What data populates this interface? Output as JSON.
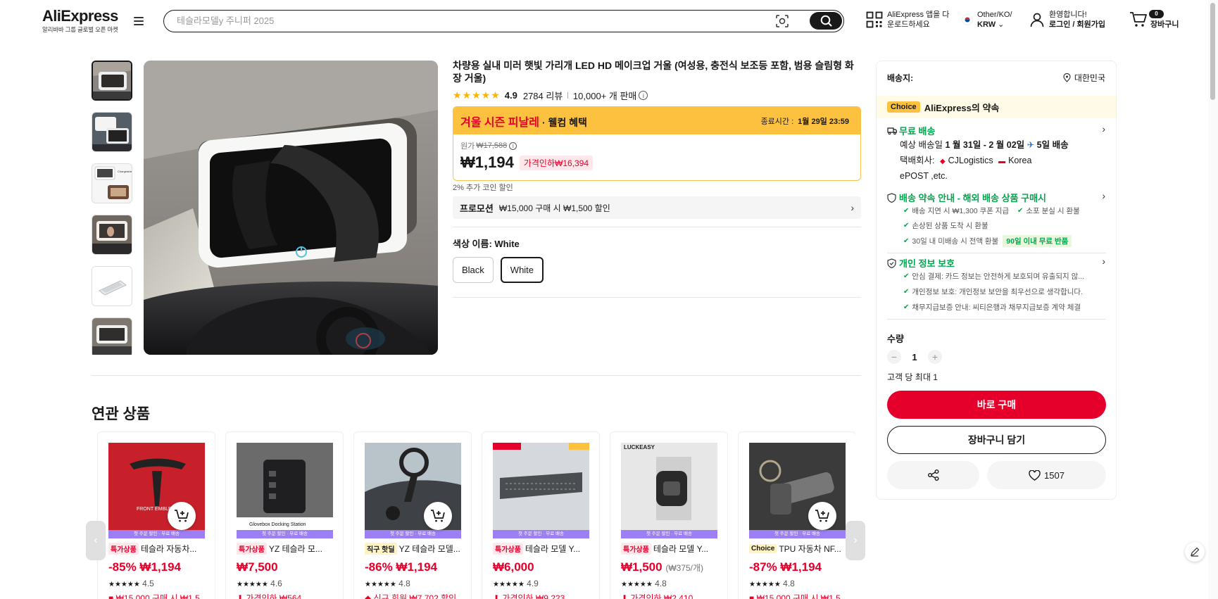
{
  "header": {
    "logo": "AliExpress",
    "logo_sub": "알리바바 그룹 글로벌 오픈 마켓",
    "search_placeholder": "테슬라모델y 주니퍼 2025",
    "app_line1": "AliExpress 앱을 다",
    "app_line2": "운로드하세요",
    "region_line1": "Other/KO/",
    "region_line2": "KRW",
    "account_line1": "환영합니다!",
    "account_line2": "로그인 / 회원가입",
    "cart_count": "0",
    "cart_label": "장바구니"
  },
  "product": {
    "title": "차량용 실내 미러 햇빛 가리개 LED HD 메이크업 거울 (여성용, 충전식 보조등 포함, 범용 슬림형 화장 거울)",
    "rating": "4.9",
    "reviews": "2784 리뷰",
    "sold": "10,000+ 개 판매",
    "deal_name": "겨울 시즌 피날레",
    "deal_sub": "· 웰컴 혜택",
    "deal_end_label": "종료시간 :",
    "deal_end_time": "1월 29일 23:59",
    "orig_label": "원가",
    "orig_price": "₩17,588",
    "price": "₩1,194",
    "discount": "가격인하₩16,394",
    "coin": "2% 추가 코인 할인",
    "promo_label": "프로모션",
    "promo_text": "₩15,000 구매 시 ₩1,500 할인",
    "color_label": "색상 이름:",
    "color_value": "White",
    "colors": [
      "Black",
      "White"
    ],
    "selected_color": "White"
  },
  "related": {
    "title": "연관 상품",
    "strip": "첫 주문 할인 · 무료 배송",
    "items": [
      {
        "tag": "특가상품",
        "tag_style": "red",
        "name": "테슬라 자동차...",
        "price": "-85% ₩1,194",
        "unit": "",
        "price_style": "red",
        "rating": "4.5",
        "promo": "₩15,000 구매 시 ₩1,5"
      },
      {
        "tag": "특가상품",
        "tag_style": "red",
        "name": "YZ 테슬라 모...",
        "price": "₩7,500",
        "unit": "",
        "price_style": "red",
        "rating": "4.6",
        "promo": "가격인하 ₩564"
      },
      {
        "tag": "직구 핫딜",
        "tag_style": "yellow",
        "name": "YZ 테슬라 모델...",
        "price": "-86% ₩1,194",
        "unit": "",
        "price_style": "red",
        "rating": "4.8",
        "promo": "신규 회원 ₩7,702 할인"
      },
      {
        "tag": "특가상품",
        "tag_style": "red",
        "name": "테슬라 모델 Y...",
        "price": "₩6,000",
        "unit": "",
        "price_style": "red",
        "rating": "4.9",
        "promo": "가격인하 ₩9,223"
      },
      {
        "tag": "특가상품",
        "tag_style": "red",
        "name": "테슬라 모델 Y...",
        "price": "₩1,500",
        "unit": "(₩375/개)",
        "price_style": "red",
        "rating": "4.8",
        "promo": "가격인하 ₩2,410"
      },
      {
        "tag": "Choice",
        "tag_style": "yellow",
        "name": "TPU 자동차 NF...",
        "price": "-87% ₩1,194",
        "unit": "",
        "price_style": "red",
        "rating": "4.8",
        "promo": "₩15,000 구매 시 ₩1,5"
      }
    ]
  },
  "panel": {
    "ship_to": "배송지:",
    "ship_loc": "대한민국",
    "choice_badge": "Choice",
    "choice_text": "AliExpress의 약속",
    "free_ship": "무료 배송",
    "est_prefix": "예상 배송일",
    "est_dates": "1 월 31일 - 2 월 02일",
    "est_days": "5일 배송",
    "carrier_label": "택배회사:",
    "carrier1": "CJLogistics",
    "carrier2": "Korea",
    "carrier3": "ePOST ,etc.",
    "promise_title": "배송 약속 안내 - 해외 배송 상품 구매시",
    "promise1": "배송 지연 시 ₩1,300 쿠폰 지급",
    "promise2": "소포 분실 시 환불",
    "promise3": "손상된 상품 도착 시 환불",
    "promise4": "30일 내 미배송 시 전액 환불",
    "promise4_tag": "90일 이내 무료 반품",
    "privacy_title": "개인 정보 보호",
    "privacy1": "안심 결제: 카드 정보는 안전하게 보호되며 유출되지 않...",
    "privacy2": "개인정보 보호: 개인정보 보안을 최우선으로 생각합니다.",
    "privacy3": "채무지급보증 안내: 씨티은행과 채무지급보증 계약 체결",
    "qty_label": "수량",
    "qty_value": "1",
    "qty_limit": "고객 당 최대 1",
    "buy_now": "바로 구매",
    "add_cart": "장바구니 담기",
    "wishlist_count": "1507"
  }
}
